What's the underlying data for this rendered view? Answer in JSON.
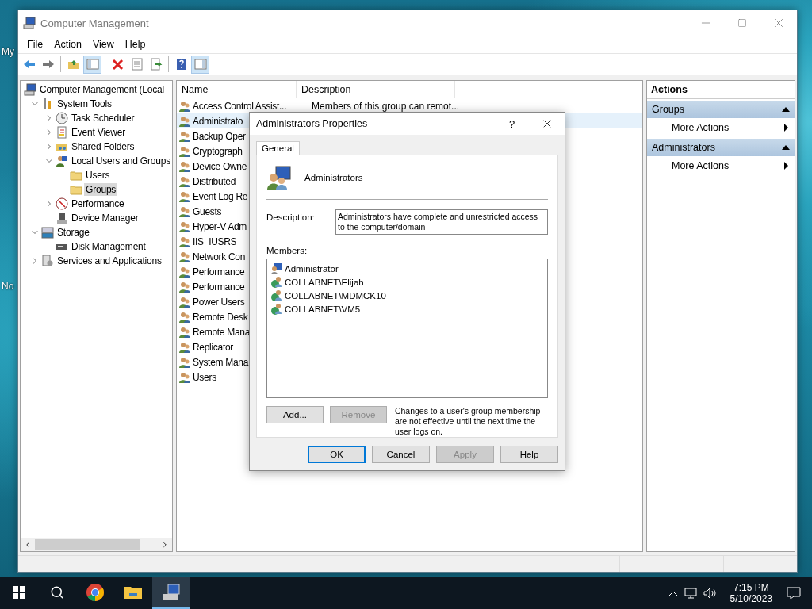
{
  "desktop": {
    "icon_labels": [
      "My",
      "No"
    ]
  },
  "window": {
    "title": "Computer Management",
    "menu": [
      "File",
      "Action",
      "View",
      "Help"
    ],
    "toolbar": [
      {
        "kind": "back",
        "pressed": false
      },
      {
        "kind": "forward",
        "pressed": false
      },
      {
        "kind": "separator"
      },
      {
        "kind": "up",
        "pressed": false
      },
      {
        "kind": "tree",
        "pressed": true
      },
      {
        "kind": "separator"
      },
      {
        "kind": "delete",
        "pressed": false
      },
      {
        "kind": "properties",
        "pressed": false
      },
      {
        "kind": "export",
        "pressed": false
      },
      {
        "kind": "separator"
      },
      {
        "kind": "help",
        "pressed": false
      },
      {
        "kind": "pane",
        "pressed": true
      }
    ],
    "tree": [
      {
        "label": "Computer Management (Local",
        "kind": "computer",
        "selected": false,
        "children": [
          {
            "label": "System Tools",
            "kind": "tools",
            "expanded": true,
            "selected": false,
            "children": [
              {
                "label": "Task Scheduler",
                "kind": "clock",
                "expanded": false,
                "selected": false
              },
              {
                "label": "Event Viewer",
                "kind": "event",
                "expanded": false,
                "selected": false
              },
              {
                "label": "Shared Folders",
                "kind": "shared",
                "expanded": false,
                "selected": false
              },
              {
                "label": "Local Users and Groups",
                "kind": "users",
                "expanded": true,
                "selected": false,
                "children": [
                  {
                    "label": "Users",
                    "kind": "folder",
                    "selected": false
                  },
                  {
                    "label": "Groups",
                    "kind": "folder",
                    "selected": true
                  }
                ]
              },
              {
                "label": "Performance",
                "kind": "perf",
                "expanded": false,
                "selected": false
              },
              {
                "label": "Device Manager",
                "kind": "device",
                "selected": false
              }
            ]
          },
          {
            "label": "Storage",
            "kind": "storage",
            "expanded": true,
            "selected": false,
            "children": [
              {
                "label": "Disk Management",
                "kind": "disk",
                "selected": false
              }
            ]
          },
          {
            "label": "Services and Applications",
            "kind": "services",
            "expanded": false,
            "selected": false
          }
        ]
      }
    ],
    "list": {
      "columns": [
        "Name",
        "Description"
      ],
      "rows": [
        {
          "name": "Access Control Assist...",
          "description": "Members of this group can remot...",
          "selected": false
        },
        {
          "name": "Administrato",
          "selected": true
        },
        {
          "name": "Backup Oper",
          "selected": false
        },
        {
          "name": "Cryptograph",
          "selected": false
        },
        {
          "name": "Device Owne",
          "selected": false
        },
        {
          "name": "Distributed",
          "selected": false
        },
        {
          "name": "Event Log Re",
          "selected": false
        },
        {
          "name": "Guests",
          "selected": false
        },
        {
          "name": "Hyper-V Adm",
          "selected": false
        },
        {
          "name": "IIS_IUSRS",
          "selected": false
        },
        {
          "name": "Network Con",
          "selected": false
        },
        {
          "name": "Performance",
          "selected": false
        },
        {
          "name": "Performance",
          "selected": false
        },
        {
          "name": "Power Users",
          "selected": false
        },
        {
          "name": "Remote Desk",
          "selected": false
        },
        {
          "name": "Remote Mana",
          "selected": false
        },
        {
          "name": "Replicator",
          "selected": false
        },
        {
          "name": "System Mana",
          "selected": false
        },
        {
          "name": "Users",
          "selected": false
        }
      ]
    },
    "actions": {
      "title": "Actions",
      "sections": [
        {
          "title": "Groups",
          "items": [
            "More Actions"
          ]
        },
        {
          "title": "Administrators",
          "items": [
            "More Actions"
          ]
        }
      ]
    }
  },
  "dialog": {
    "title": "Administrators Properties",
    "help": "?",
    "tabs": [
      {
        "label": "General",
        "selected": true
      }
    ],
    "group_name": "Administrators",
    "description_label": "Description:",
    "description": "Administrators have complete and unrestricted access to the computer/domain",
    "members_label": "Members:",
    "members": [
      {
        "name": "Administrator",
        "kind": "user"
      },
      {
        "name": "COLLABNET\\Elijah",
        "kind": "domain"
      },
      {
        "name": "COLLABNET\\MDMCK10",
        "kind": "domain"
      },
      {
        "name": "COLLABNET\\VM5",
        "kind": "domain"
      }
    ],
    "member_buttons": [
      {
        "label": "Add...",
        "disabled": false
      },
      {
        "label": "Remove",
        "disabled": true
      }
    ],
    "note": "Changes to a user's group membership are not effective until the next time the user logs on.",
    "buttons": [
      {
        "label": "OK",
        "disabled": false,
        "default": true
      },
      {
        "label": "Cancel",
        "disabled": false,
        "default": false
      },
      {
        "label": "Apply",
        "disabled": true,
        "default": false
      },
      {
        "label": "Help",
        "disabled": false,
        "default": false
      }
    ]
  },
  "taskbar": {
    "apps": [
      {
        "kind": "chrome",
        "active": false
      },
      {
        "kind": "explorer",
        "active": false
      },
      {
        "kind": "compmgmt",
        "active": true
      }
    ],
    "time": "7:15 PM",
    "date": "5/10/2023"
  }
}
